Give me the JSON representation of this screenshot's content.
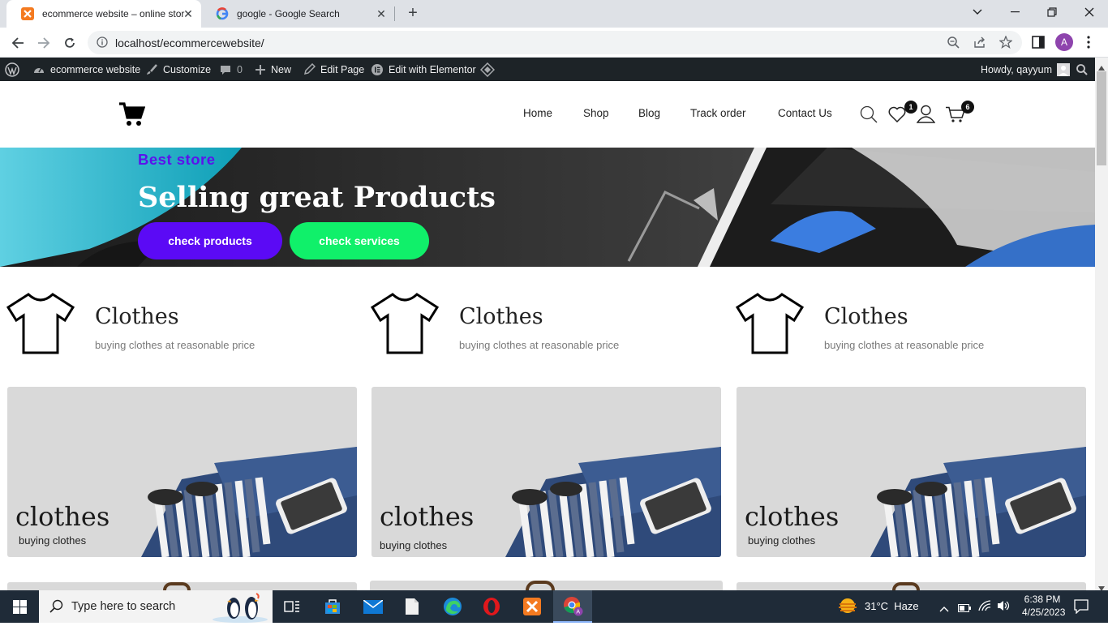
{
  "browser": {
    "tabs": [
      {
        "title": "ecommerce website – online stor",
        "active": true
      },
      {
        "title": "google - Google Search",
        "active": false
      }
    ],
    "url": "localhost/ecommercewebsite/",
    "profile_initial": "A"
  },
  "adminbar": {
    "site_name": "ecommerce website",
    "customize": "Customize",
    "comments_count": "0",
    "new_label": "New",
    "edit_page": "Edit Page",
    "elementor": "Edit with Elementor",
    "howdy": "Howdy, qayyum"
  },
  "header": {
    "nav": [
      "Home",
      "Shop",
      "Blog",
      "Track order",
      "Contact Us"
    ],
    "wishlist_count": "1",
    "cart_count": "6"
  },
  "hero": {
    "kicker": "Best store",
    "heading": "Selling great Products",
    "btn_products": "check products",
    "btn_services": "check services"
  },
  "features": [
    {
      "title": "Clothes",
      "sub": "buying clothes at reasonable price"
    },
    {
      "title": "Clothes",
      "sub": "buying clothes at reasonable price"
    },
    {
      "title": "Clothes",
      "sub": "buying clothes at reasonable price"
    }
  ],
  "cards": [
    {
      "title": "clothes",
      "sub": "buying clothes"
    },
    {
      "title": "clothes",
      "sub": "buying clothes"
    },
    {
      "title": "clothes",
      "sub": "buying clothes"
    }
  ],
  "taskbar": {
    "search_placeholder": "Type here to search",
    "weather": "31°C  Haze",
    "time": "6:38 PM",
    "date": "4/25/2023"
  },
  "colors": {
    "kicker": "#5b13ec",
    "btn_products": "#5b0af5",
    "btn_services": "#10f06a",
    "adminbar": "#1d2327",
    "taskbar": "#1f2b38"
  }
}
